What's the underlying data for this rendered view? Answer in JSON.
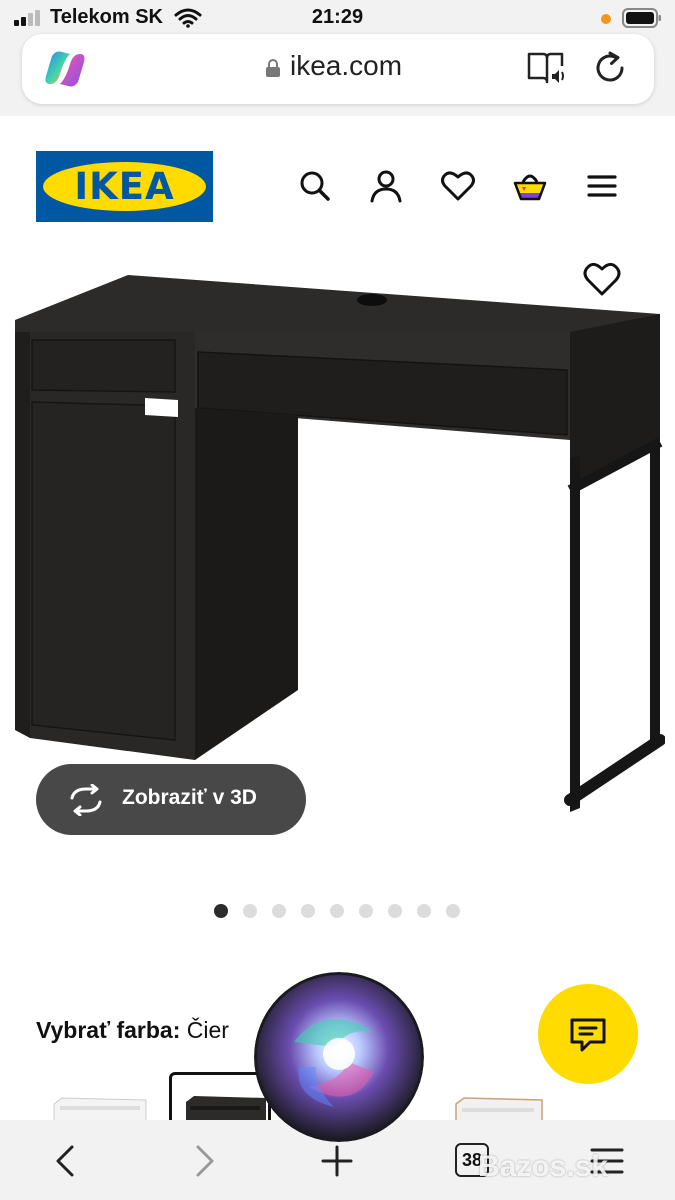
{
  "status_bar": {
    "carrier": "Telekom SK",
    "time": "21:29"
  },
  "browser": {
    "url": "ikea.com",
    "tab_count": "38"
  },
  "header": {
    "logo_text": "IKEA",
    "brand_colors": {
      "blue": "#0058a3",
      "yellow": "#ffdb00"
    }
  },
  "product": {
    "view_3d_label": "Zobraziť v 3D",
    "carousel": {
      "count": 9,
      "active_index": 0
    },
    "color_label": "Vybrať farba:",
    "color_value": "Čier"
  },
  "watermark": "Bazos.sk",
  "icons": [
    "copilot-icon",
    "lock-icon",
    "reader-icon",
    "reload-icon",
    "search-icon",
    "user-icon",
    "heart-icon",
    "cart-icon",
    "menu-icon",
    "rotate-3d-icon",
    "chat-icon",
    "siri-icon",
    "back-icon",
    "forward-icon",
    "new-tab-icon",
    "tabs-icon",
    "menu-icon"
  ]
}
